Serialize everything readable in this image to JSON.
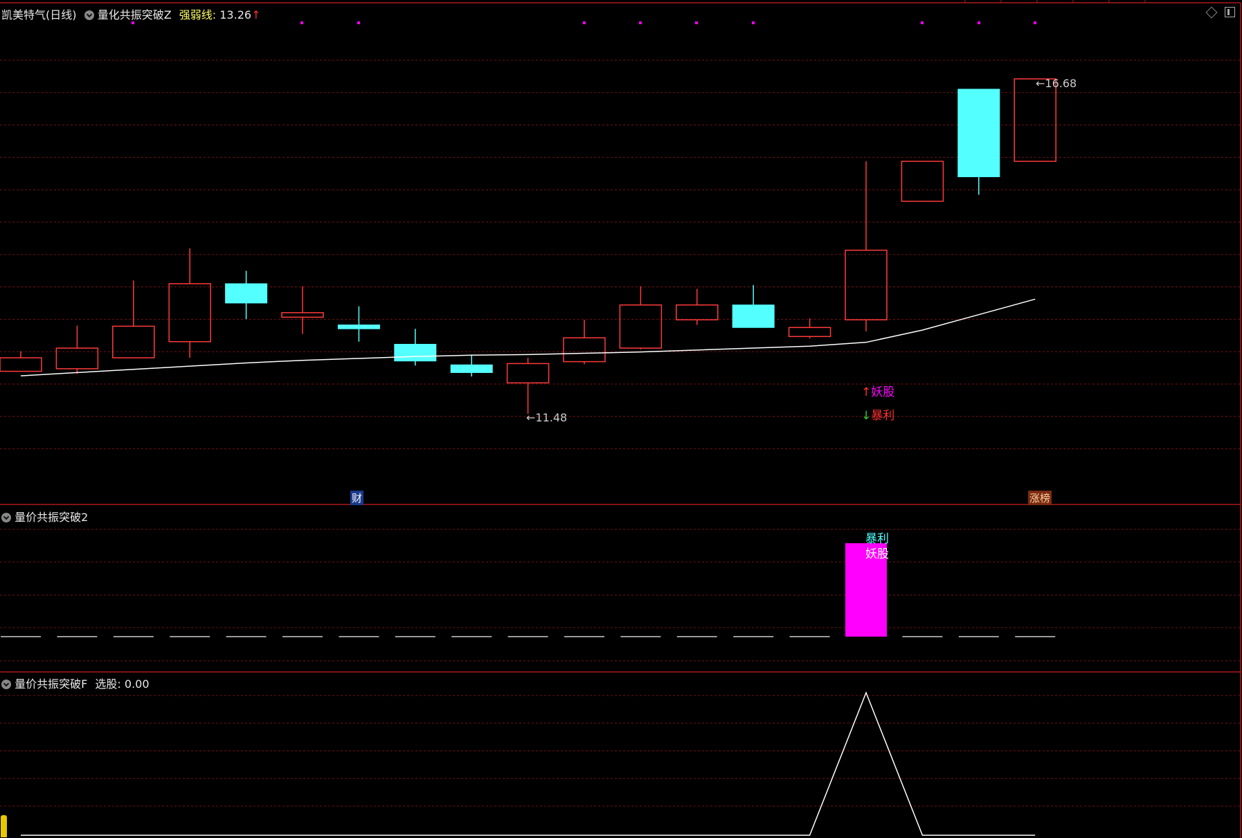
{
  "header": {
    "stock_name": "凯美特气(日线)",
    "indicator_name": "量化共振突破Z",
    "line_label": "强弱线:",
    "line_value": "13.26",
    "up_arrow": "↑"
  },
  "panel2": {
    "title": "量价共振突破2"
  },
  "panel3": {
    "title": "量价共振突破F",
    "label": "选股:",
    "value": "0.00"
  },
  "annotations": {
    "low_price": "←11.48",
    "high_price": "←16.68",
    "signal_up": "妖股",
    "signal_down": "暴利",
    "bottom_left_badge": "财",
    "bottom_right_badge": "涨榜",
    "panel2_top": "暴利",
    "panel2_bottom": "妖股"
  },
  "colors": {
    "up_candle": "#ff3b3b",
    "down_candle": "#54ffff",
    "ma_line": "#ffffff",
    "grid": "#7a1010",
    "separator": "#b01818",
    "magenta": "#ff00ff",
    "dot": "#ff00ff"
  },
  "chart_data": [
    {
      "type": "candlestick",
      "title": "凯美特气(日线)",
      "series": [
        {
          "name": "强弱线",
          "values": [
            12.07,
            12.12,
            12.17,
            12.22,
            12.27,
            12.31,
            12.34,
            12.37,
            12.39,
            12.4,
            12.42,
            12.44,
            12.47,
            12.5,
            12.53,
            12.59,
            12.78,
            13.02,
            13.26
          ]
        }
      ],
      "candles": [
        {
          "open": 12.14,
          "close": 12.35,
          "high": 12.45,
          "low": 12.14,
          "color": "up"
        },
        {
          "open": 12.18,
          "close": 12.5,
          "high": 12.85,
          "low": 12.1,
          "color": "up"
        },
        {
          "open": 12.35,
          "close": 12.84,
          "high": 13.55,
          "low": 12.35,
          "color": "up"
        },
        {
          "open": 12.6,
          "close": 13.5,
          "high": 14.05,
          "low": 12.35,
          "color": "up"
        },
        {
          "open": 13.5,
          "close": 13.2,
          "high": 13.7,
          "low": 12.95,
          "color": "down"
        },
        {
          "open": 12.98,
          "close": 13.05,
          "high": 13.46,
          "low": 12.72,
          "color": "up"
        },
        {
          "open": 12.86,
          "close": 12.8,
          "high": 13.15,
          "low": 12.6,
          "color": "down"
        },
        {
          "open": 12.56,
          "close": 12.3,
          "high": 12.8,
          "low": 12.23,
          "color": "down"
        },
        {
          "open": 12.24,
          "close": 12.12,
          "high": 12.4,
          "low": 12.06,
          "color": "down"
        },
        {
          "open": 11.96,
          "close": 12.26,
          "high": 12.35,
          "low": 11.48,
          "color": "up"
        },
        {
          "open": 12.29,
          "close": 12.66,
          "high": 12.94,
          "low": 12.25,
          "color": "up"
        },
        {
          "open": 12.5,
          "close": 13.17,
          "high": 13.46,
          "low": 12.48,
          "color": "up"
        },
        {
          "open": 12.94,
          "close": 13.17,
          "high": 13.42,
          "low": 12.86,
          "color": "up"
        },
        {
          "open": 13.17,
          "close": 12.82,
          "high": 13.48,
          "low": 12.82,
          "color": "down"
        },
        {
          "open": 12.68,
          "close": 12.82,
          "high": 12.96,
          "low": 12.65,
          "color": "up"
        },
        {
          "open": 12.94,
          "close": 14.02,
          "high": 15.4,
          "low": 12.76,
          "color": "up"
        },
        {
          "open": 14.78,
          "close": 15.4,
          "high": 15.4,
          "low": 14.78,
          "color": "up"
        },
        {
          "open": 16.52,
          "close": 15.16,
          "high": 16.52,
          "low": 14.88,
          "color": "down"
        },
        {
          "open": 15.4,
          "close": 16.68,
          "high": 16.68,
          "low": 15.4,
          "color": "up"
        }
      ],
      "annotations": {
        "low": 11.48,
        "high": 16.68
      }
    },
    {
      "type": "bar",
      "title": "量价共振突破2",
      "series": [
        {
          "values": [
            0,
            0,
            0,
            0,
            0,
            0,
            0,
            0,
            0,
            0,
            0,
            0,
            0,
            0,
            0,
            1,
            0,
            0,
            0
          ]
        }
      ]
    },
    {
      "type": "line",
      "title": "量价共振突破F",
      "series": [
        {
          "name": "选股",
          "values": [
            0,
            0,
            0,
            0,
            0,
            0,
            0,
            0,
            0,
            0,
            0,
            0,
            0,
            0,
            0,
            1,
            0,
            0,
            0
          ]
        }
      ]
    }
  ]
}
